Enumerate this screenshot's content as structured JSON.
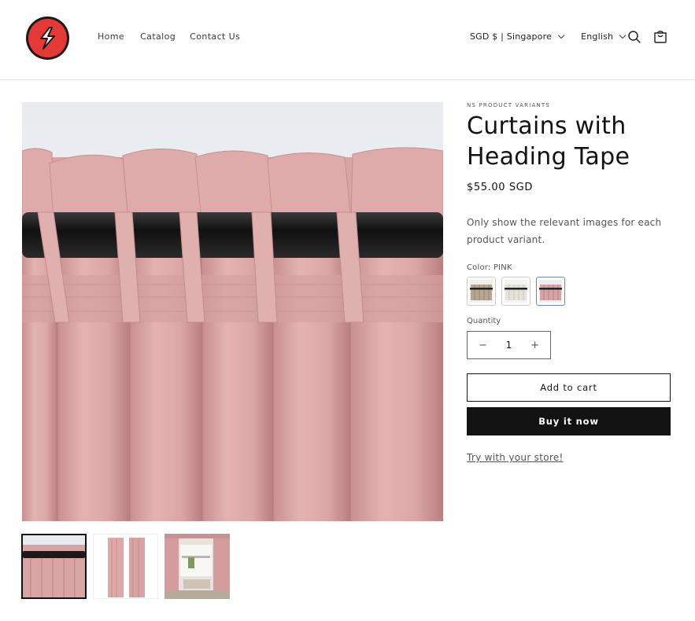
{
  "header": {
    "logo_icon": "lightning-s-logo",
    "nav": [
      {
        "label": "Home"
      },
      {
        "label": "Catalog"
      },
      {
        "label": "Contact Us"
      }
    ],
    "currency": "SGD $ | Singapore",
    "language": "English",
    "search_icon": "search-icon",
    "cart_icon": "cart-icon"
  },
  "product": {
    "vendor": "NS PRODUCT VARIANTS",
    "title": "Curtains with Heading Tape",
    "price": "$55.00 SGD",
    "description": "Only show the relevant images for each product variant.",
    "color_label": "Color: PINK",
    "swatches": [
      {
        "name": "beige",
        "color": "#b8a690"
      },
      {
        "name": "white",
        "color": "#e8e6df"
      },
      {
        "name": "pink",
        "color": "#d9a3a6",
        "selected": true
      }
    ],
    "quantity_label": "Quantity",
    "quantity_value": "1",
    "add_to_cart": "Add to cart",
    "buy_now": "Buy it now",
    "try_link": "Try with your store!"
  },
  "colors": {
    "curtain_pink": "#dcaaa9",
    "rod": "#1c1c1c",
    "logo_red": "#e53935",
    "button_dark": "#121212"
  }
}
